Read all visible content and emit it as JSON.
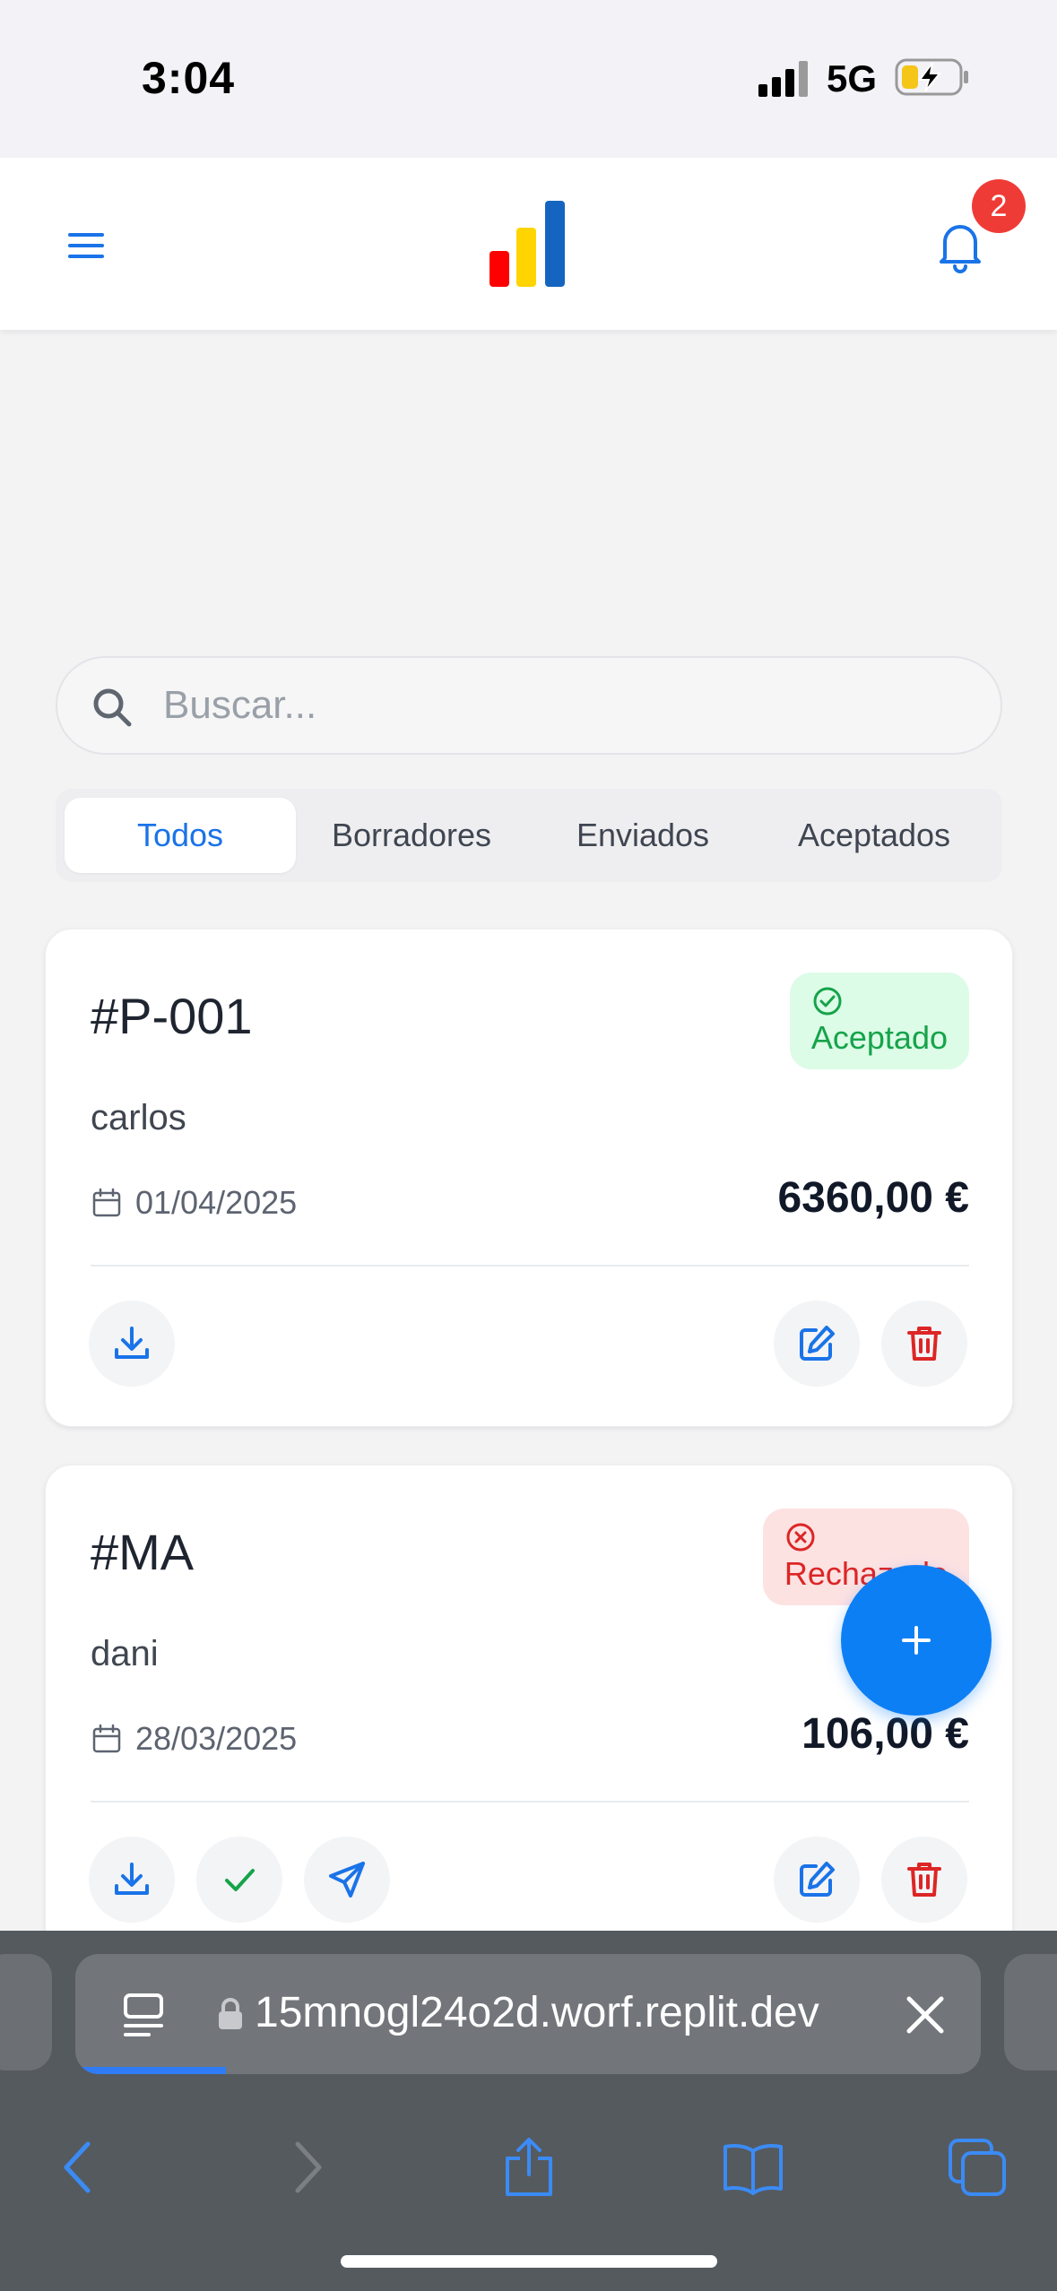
{
  "status_bar": {
    "time": "3:04",
    "network": "5G"
  },
  "header": {
    "menu_icon": "hamburger-menu-icon",
    "logo_icon": "bar-chart-logo",
    "logo_colors": [
      "#ff0000",
      "#ffd400",
      "#1565c0"
    ],
    "notification_icon": "bell-icon",
    "notification_count": "2"
  },
  "search": {
    "placeholder": "Buscar...",
    "value": ""
  },
  "tabs": [
    {
      "label": "Todos",
      "active": true
    },
    {
      "label": "Borradores",
      "active": false
    },
    {
      "label": "Enviados",
      "active": false
    },
    {
      "label": "Aceptados",
      "active": false
    }
  ],
  "quotes": [
    {
      "id": "#P-001",
      "status": "Aceptado",
      "status_icon": "check-circle-icon",
      "client": "carlos",
      "date": "01/04/2025",
      "amount": "6360,00 €",
      "actions": [
        "download-icon",
        "edit-icon",
        "trash-icon"
      ]
    },
    {
      "id": "#MA",
      "status": "Rechazado",
      "status_icon": "x-circle-icon",
      "client": "dani",
      "date": "28/03/2025",
      "amount": "106,00 €",
      "actions": [
        "download-icon",
        "check-icon",
        "send-icon",
        "edit-icon",
        "trash-icon"
      ]
    }
  ],
  "fab": {
    "icon": "plus-icon"
  },
  "browser": {
    "url": "15mnogl24o2d.worf.replit.dev",
    "nav": [
      "back-icon",
      "forward-icon",
      "share-icon",
      "bookmarks-icon",
      "tabs-icon"
    ]
  },
  "colors": {
    "accent": "#1a73e8",
    "fab": "#0d7ff5",
    "accepted": "#16a34a",
    "rejected": "#dc2626",
    "badge": "#ef3b36"
  }
}
